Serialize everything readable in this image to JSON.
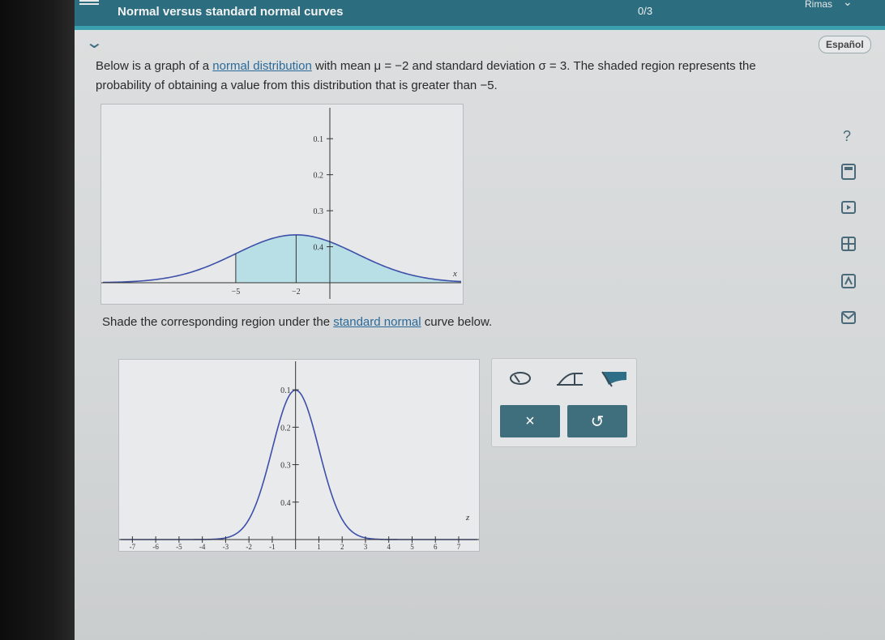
{
  "header": {
    "title": "Normal versus standard normal curves",
    "progress": "0/3",
    "user": "Rimas"
  },
  "language_button": "Español",
  "problem": {
    "p1": "Below is a graph of a ",
    "link1": "normal distribution",
    "p2": " with mean ",
    "mean_expr": "μ = −2",
    "p3": " and standard deviation ",
    "sd_expr": "σ = 3",
    "p4": ". The shaded region represents the probability of obtaining a value from this distribution that is greater than ",
    "threshold": "−5",
    "p5": "."
  },
  "instruction": {
    "p1": "Shade the corresponding region under the ",
    "link": "standard normal",
    "p2": " curve below."
  },
  "graph1": {
    "y_ticks": [
      "0.4",
      "0.3",
      "0.2",
      "0.1"
    ],
    "x_ticks": [
      "−5",
      "−2"
    ],
    "axis_label": "x"
  },
  "graph2": {
    "y_ticks": [
      "0.4",
      "0.3",
      "0.2",
      "0.1"
    ],
    "x_ticks": [
      "-7",
      "-6",
      "-5",
      "-4",
      "-3",
      "-2",
      "-1",
      "1",
      "2",
      "3",
      "4",
      "5",
      "6",
      "7"
    ],
    "axis_label": "z"
  },
  "palette": {
    "clear_label": "×",
    "undo_label": "↺"
  },
  "side_tools": [
    "help-icon",
    "calculator-icon",
    "video-icon",
    "data-icon",
    "textbook-icon",
    "message-icon"
  ],
  "colors": {
    "header": "#2c6e80",
    "shade": "#b8dfe6",
    "curve": "#3d4fa8",
    "button": "#3f6e7c"
  },
  "chart_data": [
    {
      "type": "area",
      "description_curve": "normal density",
      "mean": -2,
      "sd": 3,
      "shaded_from": -5,
      "ylim": [
        0,
        0.45
      ],
      "y_ticks": [
        0.1,
        0.2,
        0.3,
        0.4
      ],
      "x_ticks": [
        -5,
        -2
      ],
      "xlabel": "x"
    },
    {
      "type": "line",
      "mean": 0,
      "sd": 1,
      "xlim": [
        -7,
        7
      ],
      "ylim": [
        0,
        0.45
      ],
      "y_ticks": [
        0.1,
        0.2,
        0.3,
        0.4
      ],
      "x_ticks": [
        -7,
        -6,
        -5,
        -4,
        -3,
        -2,
        -1,
        1,
        2,
        3,
        4,
        5,
        6,
        7
      ],
      "xlabel": "z"
    }
  ]
}
